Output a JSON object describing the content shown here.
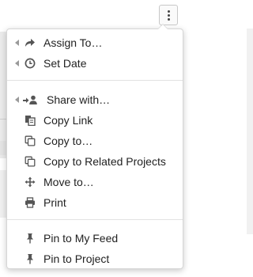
{
  "toolbar": {
    "more_icon": "kebab-vertical-icon"
  },
  "menu": {
    "groups": [
      {
        "items": [
          {
            "label": "Assign To…",
            "icon": "share-arrow-icon",
            "submenu": true
          },
          {
            "label": "Set Date",
            "icon": "clock-icon",
            "submenu": true
          }
        ]
      },
      {
        "items": [
          {
            "label": "Share with…",
            "icon": "share-user-icon",
            "submenu": true
          },
          {
            "label": "Copy Link",
            "icon": "copy-link-icon",
            "submenu": false
          },
          {
            "label": "Copy to…",
            "icon": "copy-icon",
            "submenu": false
          },
          {
            "label": "Copy to Related Projects",
            "icon": "copy-icon",
            "submenu": false
          },
          {
            "label": "Move to…",
            "icon": "move-icon",
            "submenu": false
          },
          {
            "label": "Print",
            "icon": "print-icon",
            "submenu": false
          }
        ]
      },
      {
        "items": [
          {
            "label": "Pin to My Feed",
            "icon": "pin-icon",
            "submenu": false
          },
          {
            "label": "Pin to Project",
            "icon": "pin-icon",
            "submenu": false
          }
        ]
      }
    ]
  },
  "colors": {
    "text": "#222222",
    "icon": "#555555",
    "separator": "#e2e2e2",
    "submenu_arrow": "#9a9a9a"
  }
}
